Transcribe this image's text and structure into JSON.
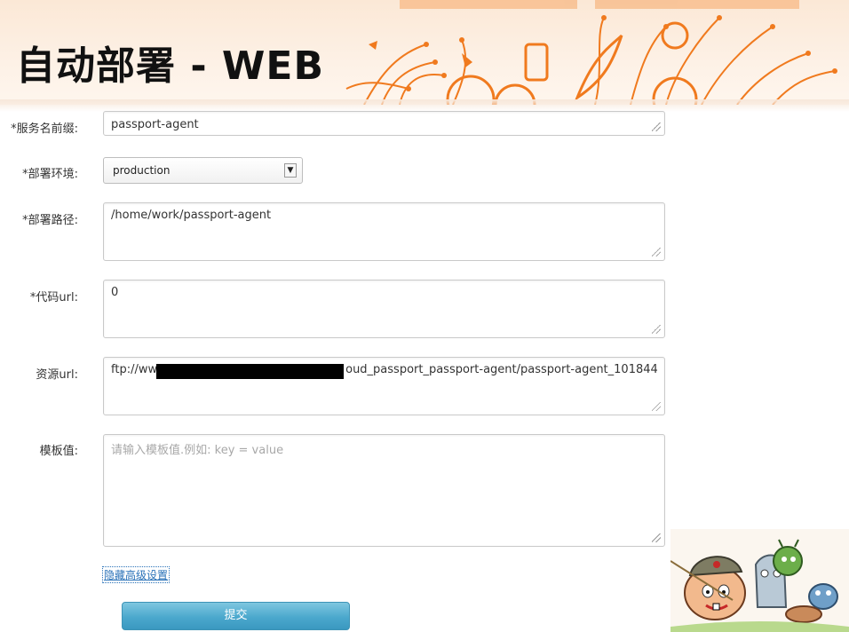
{
  "header": {
    "title": "自动部署 - WEB"
  },
  "form": {
    "service_prefix": {
      "label": "*服务名前缀:",
      "value": "passport-agent"
    },
    "deploy_env": {
      "label": "*部署环境:",
      "value": "production"
    },
    "deploy_path": {
      "label": "*部署路径:",
      "value": "/home/work/passport-agent"
    },
    "code_url": {
      "label": "*代码url:",
      "value": "0"
    },
    "resource_url": {
      "label": "资源url:",
      "value_prefix": "ftp://ww",
      "value_suffix": "oud_passport_passport-agent/passport-agent_101844"
    },
    "template_value": {
      "label": "模板值:",
      "placeholder": "请输入模板值.例如:  key = value"
    }
  },
  "advanced_link": "隐藏高级设置",
  "submit_label": "提交",
  "colors": {
    "header_bg": "#fbe8d6",
    "accent_orange": "#f07a1e",
    "button_blue": "#4ba8cd",
    "link_blue": "#2a72b8"
  }
}
